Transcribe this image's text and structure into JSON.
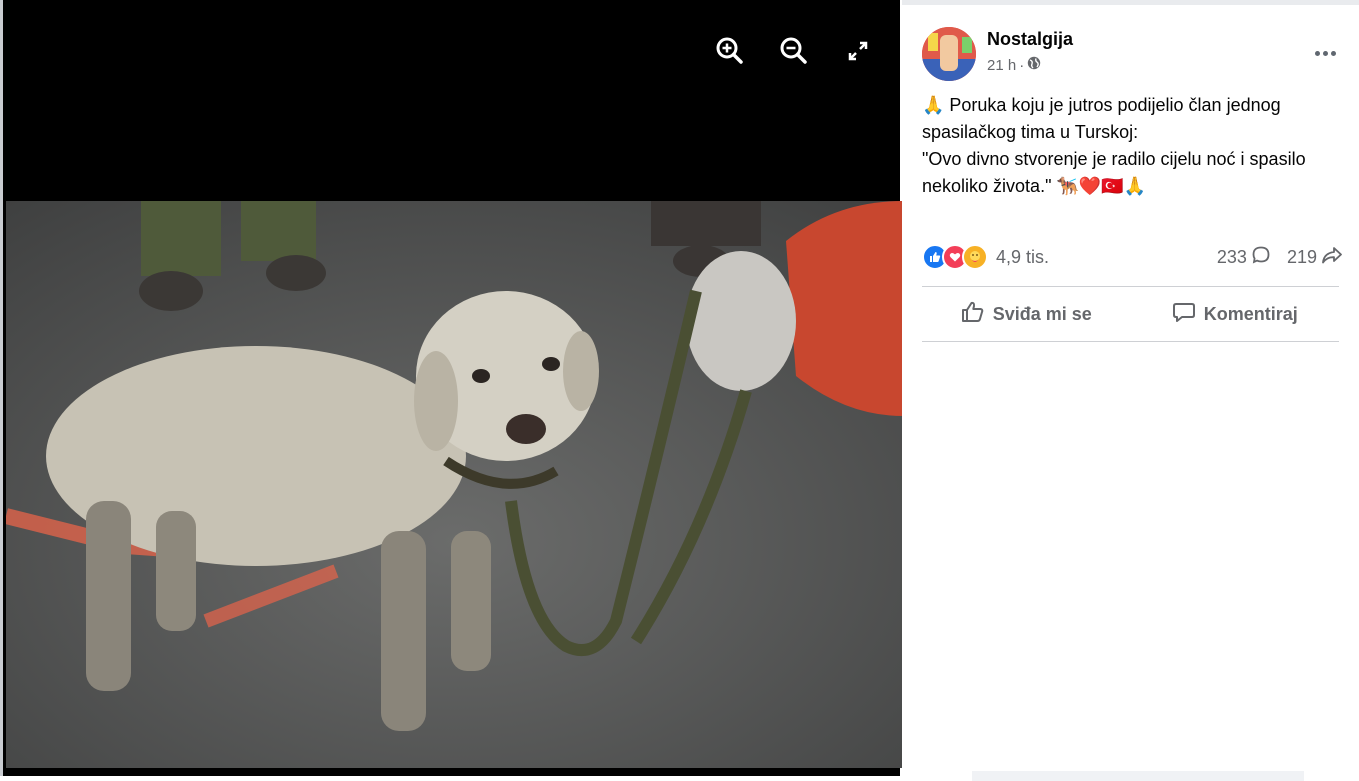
{
  "viewer": {
    "tools": [
      {
        "name": "zoom-in-icon"
      },
      {
        "name": "zoom-out-icon"
      },
      {
        "name": "fullscreen-icon"
      }
    ]
  },
  "post": {
    "author": "Nostalgija",
    "time": "21 h",
    "dot": "·",
    "audience_icon": "globe-icon",
    "text_lines": [
      "🙏 Poruka koju je jutros podijelio član jednog spasilačkog tima u Turskoj:",
      "\"Ovo divno stvorenje je radilo cijelu noć i spasilo nekoliko života.\" 🐕‍🦺❤️🇹🇷🙏"
    ],
    "reactions": {
      "icons": [
        "like-reaction-icon",
        "love-reaction-icon",
        "care-reaction-icon"
      ],
      "count": "4,9 tis."
    },
    "comments_count": "233",
    "shares_count": "219",
    "actions": {
      "like_label": "Sviđa mi se",
      "comment_label": "Komentiraj"
    }
  },
  "colors": {
    "accent": "#1877f2",
    "love": "#f33e58",
    "care": "#f7b125",
    "muted_text": "#65676b"
  }
}
